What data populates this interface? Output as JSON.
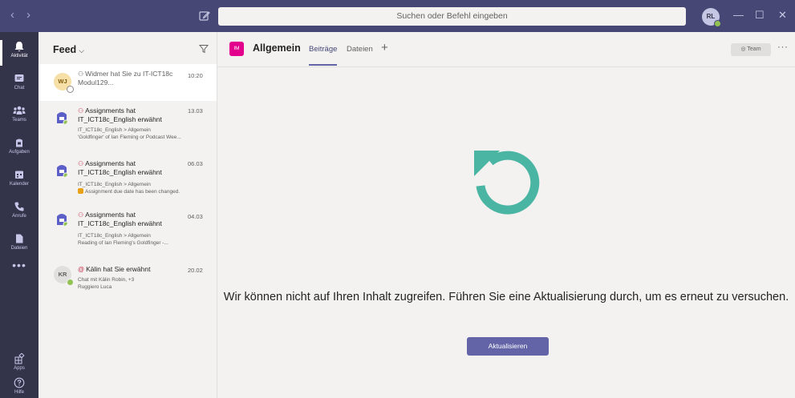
{
  "topbar": {
    "back_glyph": "‹",
    "forward_glyph": "›",
    "search_placeholder": "Suchen oder Befehl eingeben",
    "user_initials": "RL",
    "minimize_glyph": "—",
    "maximize_glyph": "☐",
    "close_glyph": "✕"
  },
  "rail": {
    "items": [
      {
        "label": "Aktivität",
        "icon": "bell-icon"
      },
      {
        "label": "Chat",
        "icon": "chat-icon"
      },
      {
        "label": "Teams",
        "icon": "teams-icon"
      },
      {
        "label": "Aufgaben",
        "icon": "tasks-icon"
      },
      {
        "label": "Kalender",
        "icon": "calendar-icon"
      },
      {
        "label": "Anrufe",
        "icon": "phone-icon"
      },
      {
        "label": "Dateien",
        "icon": "files-icon"
      }
    ],
    "more": "•••",
    "apps_label": "Apps",
    "help_label": "Hilfe"
  },
  "feed": {
    "title": "Feed",
    "chevron": "⌵",
    "items": [
      {
        "avatar": "WJ",
        "icon_glyph": "⚇",
        "title": "Widmer hat Sie zu IT-ICT18c Modul129...",
        "time": "10:20",
        "lines": []
      },
      {
        "avatar": "",
        "icon_glyph": "⚇",
        "title": "Assignments hat IT_ICT18c_English erwähnt",
        "time": "13.03",
        "lines": [
          "IT_ICT18c_English > Allgemein",
          "'Goldfinger' of Ian Fleming or Podcast Wee..."
        ]
      },
      {
        "avatar": "",
        "icon_glyph": "⚇",
        "title": "Assignments hat IT_ICT18c_English erwähnt",
        "time": "06.03",
        "lines": [
          "IT_ICT18c_English > Allgemein",
          "Assignment due date has been changed."
        ]
      },
      {
        "avatar": "",
        "icon_glyph": "⚇",
        "title": "Assignments hat IT_ICT18c_English erwähnt",
        "time": "04.03",
        "lines": [
          "IT_ICT18c_English > Allgemein",
          "Reading of Ian Fleming's Goldfinger -..."
        ]
      },
      {
        "avatar": "KR",
        "icon_glyph": "@",
        "title": "Kälin hat Sie erwähnt",
        "time": "20.02",
        "lines": [
          "Chat mit Kälin Robin, +3",
          "Ruggiero Luca"
        ]
      }
    ]
  },
  "channel": {
    "avatar": "IM",
    "name": "Allgemein",
    "tabs": [
      "Beiträge",
      "Dateien"
    ],
    "add_tab": "+",
    "team_button": "Team",
    "more": "···"
  },
  "error": {
    "message": "Wir können nicht auf Ihren Inhalt zugreifen. Führen Sie eine Aktualisierung durch, um es erneut zu versuchen.",
    "button": "Aktualisieren"
  },
  "colors": {
    "topbar": "#464775",
    "rail": "#33344a",
    "accent": "#6264a7",
    "refresh_icon": "#4ab5a3",
    "channel_avatar": "#e3008c",
    "presence": "#92c353"
  }
}
